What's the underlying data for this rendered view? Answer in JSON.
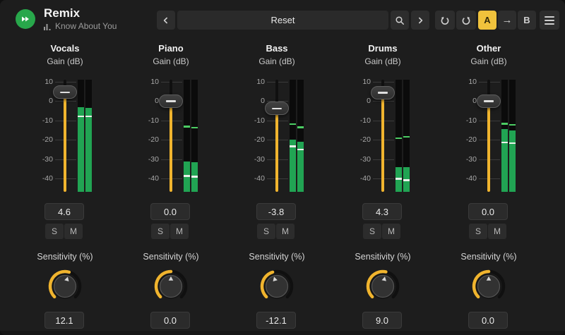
{
  "header": {
    "app_title": "Remix",
    "preset_title": "Know About You"
  },
  "toolbar": {
    "preset_display": "Reset",
    "ab_a": "A",
    "ab_arrow": "→",
    "ab_b": "B"
  },
  "colors": {
    "accent_yellow": "#f0b42e",
    "ab_active_yellow": "#f0c23c",
    "meter_green": "#21a453",
    "meter_peak_hold_green": "#4ccc63",
    "logo_green": "#28a74b",
    "background": "#1d1d1d"
  },
  "fader_scale_ticks": [
    "10",
    "0",
    "-10",
    "-20",
    "-30",
    "-40"
  ],
  "sensitivity_range": [
    -100,
    100
  ],
  "channels": [
    {
      "name": "Vocals",
      "gain_label": "Gain (dB)",
      "gain_value": "4.6",
      "gain_db": 4.6,
      "solo_label": "S",
      "mute_label": "M",
      "sensitivity_label": "Sensitivity (%)",
      "sensitivity_value": "12.1",
      "sensitivity_pct": 12.1,
      "meter": {
        "l_level_db": -3.2,
        "r_level_db": -3.4,
        "l_tick_db": -7.4,
        "r_tick_db": -7.4,
        "l_hold_db": null,
        "r_hold_db": null
      }
    },
    {
      "name": "Piano",
      "gain_label": "Gain (dB)",
      "gain_value": "0.0",
      "gain_db": 0.0,
      "solo_label": "S",
      "mute_label": "M",
      "sensitivity_label": "Sensitivity (%)",
      "sensitivity_value": "0.0",
      "sensitivity_pct": 0.0,
      "meter": {
        "l_level_db": -31.4,
        "r_level_db": -31.6,
        "l_tick_db": -38.3,
        "r_tick_db": -38.6,
        "l_hold_db": -12.8,
        "r_hold_db": -13.2
      }
    },
    {
      "name": "Bass",
      "gain_label": "Gain (dB)",
      "gain_value": "-3.8",
      "gain_db": -3.8,
      "solo_label": "S",
      "mute_label": "M",
      "sensitivity_label": "Sensitivity (%)",
      "sensitivity_value": "-12.1",
      "sensitivity_pct": -12.1,
      "meter": {
        "l_level_db": -20.0,
        "r_level_db": -21.2,
        "l_tick_db": -23.0,
        "r_tick_db": -24.5,
        "l_hold_db": -11.5,
        "r_hold_db": -13.0
      }
    },
    {
      "name": "Drums",
      "gain_label": "Gain (dB)",
      "gain_value": "4.3",
      "gain_db": 4.3,
      "solo_label": "S",
      "mute_label": "M",
      "sensitivity_label": "Sensitivity (%)",
      "sensitivity_value": "9.0",
      "sensitivity_pct": 9.0,
      "meter": {
        "l_level_db": -34.0,
        "r_level_db": -34.0,
        "l_tick_db": -39.7,
        "r_tick_db": -40.5,
        "l_hold_db": -18.8,
        "r_hold_db": -18.0
      }
    },
    {
      "name": "Other",
      "gain_label": "Gain (dB)",
      "gain_value": "0.0",
      "gain_db": 0.0,
      "solo_label": "S",
      "mute_label": "M",
      "sensitivity_label": "Sensitivity (%)",
      "sensitivity_value": "0.0",
      "sensitivity_pct": 0.0,
      "meter": {
        "l_level_db": -14.5,
        "r_level_db": -15.0,
        "l_tick_db": -21.0,
        "r_tick_db": -21.3,
        "l_hold_db": -11.3,
        "r_hold_db": -11.8
      }
    }
  ]
}
